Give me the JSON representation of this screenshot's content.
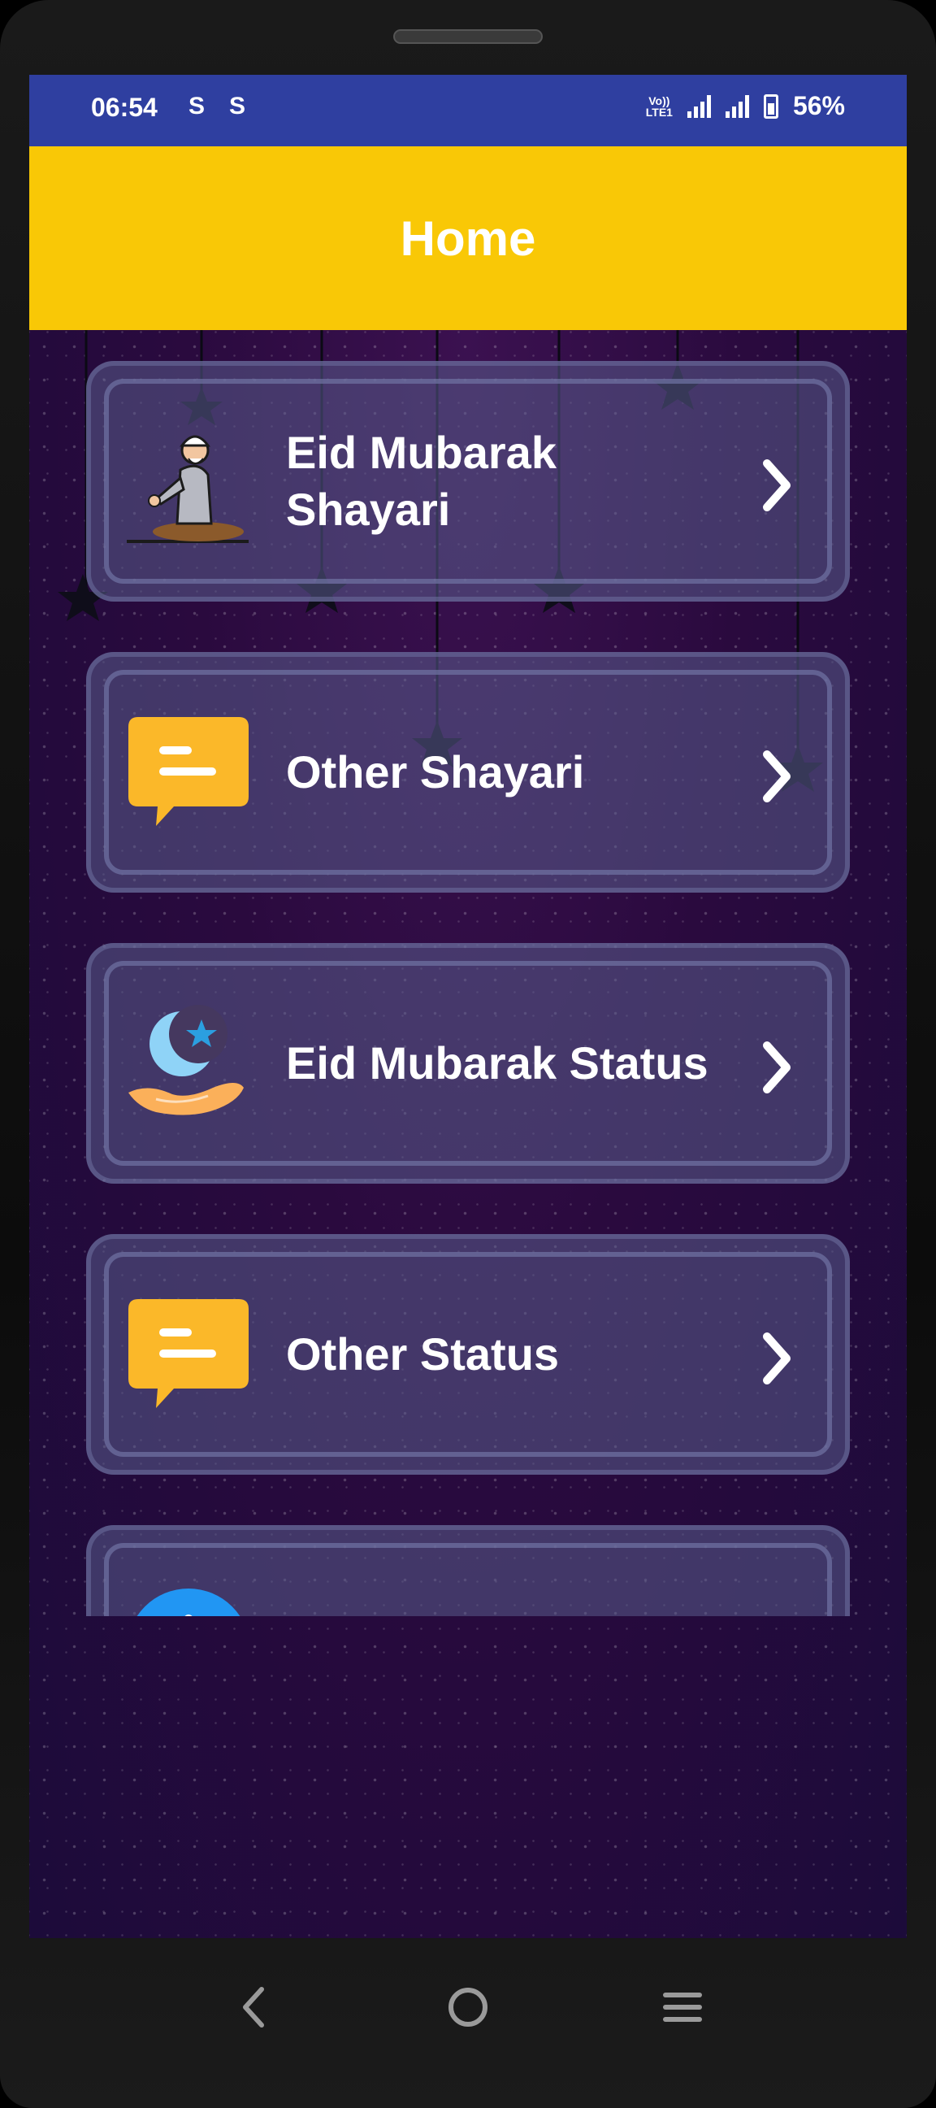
{
  "status_bar": {
    "time": "06:54",
    "notif_icons": [
      "S",
      "S"
    ],
    "volte_label": "Vo)) LTE1",
    "battery": "56%"
  },
  "app_bar": {
    "title": "Home"
  },
  "menu": [
    {
      "label": "Eid Mubarak Shayari",
      "icon": "praying-man-icon"
    },
    {
      "label": "Other Shayari",
      "icon": "chat-bubble-icon"
    },
    {
      "label": "Eid Mubarak Status",
      "icon": "crescent-moon-hand-icon"
    },
    {
      "label": "Other Status",
      "icon": "chat-bubble-icon"
    },
    {
      "label": "",
      "icon": "blue-circle-icon"
    }
  ],
  "colors": {
    "status_bar": "#2f3fa0",
    "app_bar": "#f9c806",
    "card": "#5a5c8c",
    "chat_icon": "#fbb829",
    "moon": "#8fd3f7"
  },
  "nav": {
    "back_icon": "back-icon",
    "home_icon": "home-icon",
    "menu_icon": "menu-icon"
  }
}
